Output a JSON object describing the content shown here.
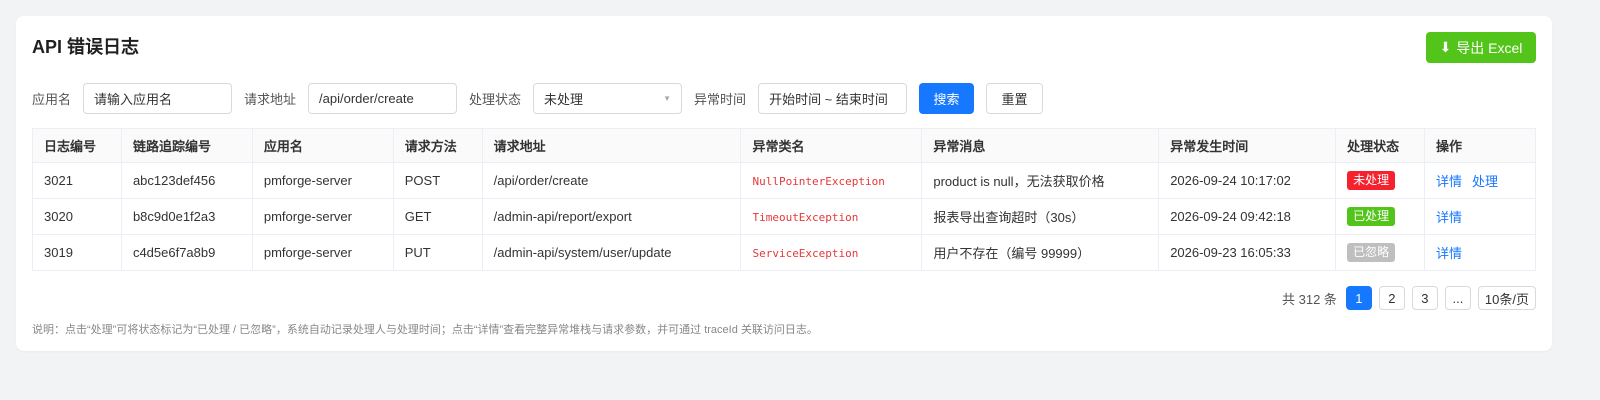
{
  "page": {
    "title": "API 错误日志",
    "export_label": "导出 Excel",
    "export_icon": "download-icon"
  },
  "filters": {
    "app_label": "应用名",
    "app_placeholder": "请输入应用名",
    "url_label": "请求地址",
    "url_value": "/api/order/create",
    "status_label": "处理状态",
    "status_value": "未处理",
    "time_label": "异常时间",
    "time_placeholder": "开始时间 ~ 结束时间",
    "search_label": "搜索",
    "reset_label": "重置"
  },
  "table": {
    "headers": [
      "日志编号",
      "链路追踪编号",
      "应用名",
      "请求方法",
      "请求地址",
      "异常类名",
      "异常消息",
      "异常发生时间",
      "处理状态",
      "操作"
    ],
    "rows": [
      {
        "id": "3021",
        "trace": "abc123def456",
        "app": "pmforge-server",
        "method": "POST",
        "url": "/api/order/create",
        "exception": "NullPointerException",
        "message": "product is null，无法获取价格",
        "time": "2026-09-24 10:17:02",
        "status": "未处理",
        "status_color": "#f5222d",
        "actions": [
          "详情",
          "处理"
        ]
      },
      {
        "id": "3020",
        "trace": "b8c9d0e1f2a3",
        "app": "pmforge-server",
        "method": "GET",
        "url": "/admin-api/report/export",
        "exception": "TimeoutException",
        "message": "报表导出查询超时（30s）",
        "time": "2026-09-24 09:42:18",
        "status": "已处理",
        "status_color": "#52c41a",
        "actions": [
          "详情"
        ]
      },
      {
        "id": "3019",
        "trace": "c4d5e6f7a8b9",
        "app": "pmforge-server",
        "method": "PUT",
        "url": "/admin-api/system/user/update",
        "exception": "ServiceException",
        "message": "用户不存在（编号 99999）",
        "time": "2026-09-23 16:05:33",
        "status": "已忽略",
        "status_color": "#bfbfbf",
        "actions": [
          "详情"
        ]
      }
    ]
  },
  "pagination": {
    "total": "共 312 条",
    "pages": [
      "1",
      "2",
      "3",
      "..."
    ],
    "active": "1",
    "page_size": "10条/页"
  },
  "note": "说明：点击“处理”可将状态标记为“已处理 / 已忽略”，系统自动记录处理人与处理时间；点击“详情”查看完整异常堆栈与请求参数，并可通过 traceId 关联访问日志。",
  "colors": {
    "primary": "#1677ff",
    "export": "#52c41a",
    "exception": "#e5383b"
  }
}
